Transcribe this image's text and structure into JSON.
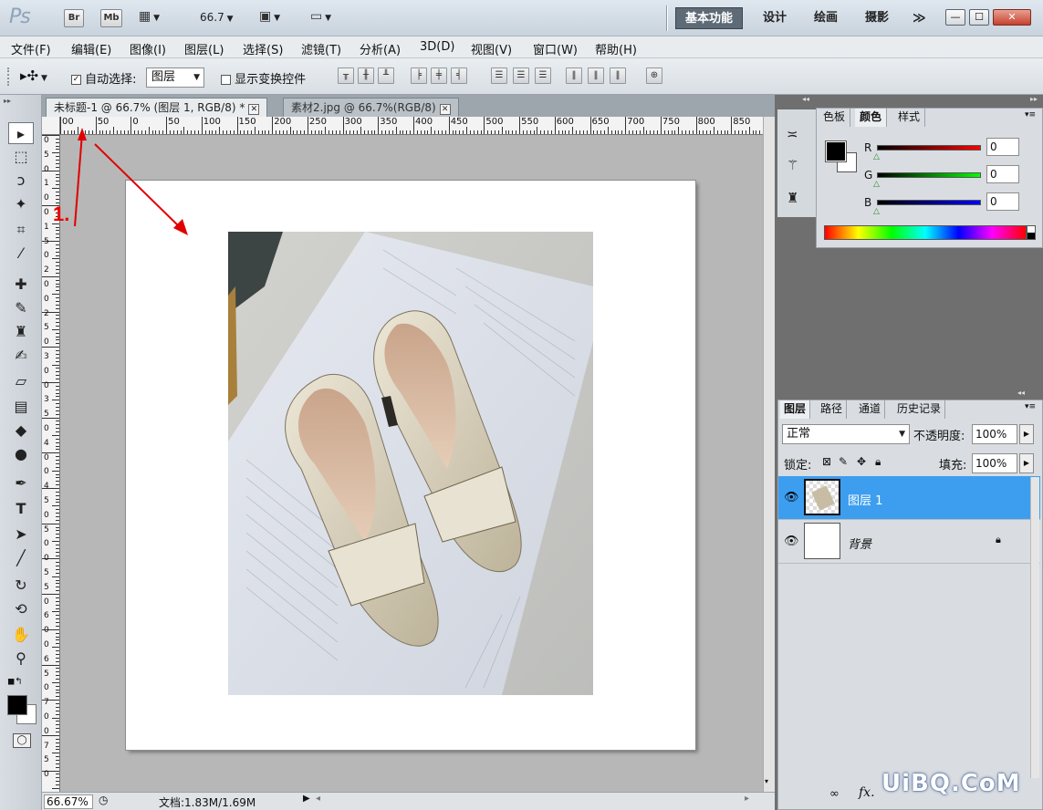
{
  "appbar": {
    "logo": "Ps",
    "bridge": "Br",
    "minibridge": "Mb",
    "zoom": "66.7",
    "workspaces": [
      "基本功能",
      "设计",
      "绘画",
      "摄影"
    ],
    "more": "≫",
    "window_buttons": [
      "—",
      "☐",
      "✕"
    ]
  },
  "menu": [
    "文件(F)",
    "编辑(E)",
    "图像(I)",
    "图层(L)",
    "选择(S)",
    "滤镜(T)",
    "分析(A)",
    "3D(D)",
    "视图(V)",
    "窗口(W)",
    "帮助(H)"
  ],
  "options": {
    "auto_select_label": "自动选择:",
    "auto_select_value": "图层",
    "show_transform_label": "显示变换控件"
  },
  "tabs": [
    {
      "label": "未标题-1 @ 66.7% (图层 1, RGB/8) *"
    },
    {
      "label": "素材2.jpg @ 66.7%(RGB/8)"
    }
  ],
  "ruler": {
    "h": [
      "00",
      "50",
      "0",
      "50",
      "100",
      "150",
      "200",
      "250",
      "300",
      "350",
      "400",
      "450",
      "500",
      "550",
      "600",
      "650",
      "700",
      "750",
      "800",
      "850"
    ],
    "v": [
      "0",
      "5",
      "0",
      "1",
      "0",
      "0",
      "1",
      "5",
      "0",
      "2",
      "0",
      "0",
      "2",
      "5",
      "0",
      "3",
      "0",
      "0",
      "3",
      "5",
      "0",
      "4",
      "0",
      "0",
      "4",
      "5",
      "0",
      "5",
      "0",
      "0",
      "5",
      "5",
      "0",
      "6",
      "0",
      "0",
      "6",
      "5",
      "0",
      "7",
      "0",
      "0",
      "7",
      "5",
      "0"
    ]
  },
  "status": {
    "zoom": "66.67%",
    "doc": "文档:1.83M/1.69M"
  },
  "color_panel": {
    "tabs": [
      "色板",
      "颜色",
      "样式"
    ],
    "channels": [
      {
        "label": "R",
        "value": "0",
        "color": "#d00000"
      },
      {
        "label": "G",
        "value": "0",
        "color": "#00c000"
      },
      {
        "label": "B",
        "value": "0",
        "color": "#0000d0"
      }
    ]
  },
  "layers_panel": {
    "tabs": [
      "图层",
      "路径",
      "通道",
      "历史记录"
    ],
    "blend_mode": "正常",
    "opacity_label": "不透明度:",
    "opacity": "100%",
    "lock_label": "锁定:",
    "fill_label": "填充:",
    "fill": "100%",
    "layers": [
      {
        "name": "图层 1",
        "selected": true
      },
      {
        "name": "背景",
        "selected": false
      }
    ],
    "footer_fx": "fx."
  },
  "annotation": {
    "step": "1."
  },
  "watermark": "UiBQ.CoM",
  "colors": {
    "selection": "#3d9ef0",
    "annotation": "#e00000"
  }
}
